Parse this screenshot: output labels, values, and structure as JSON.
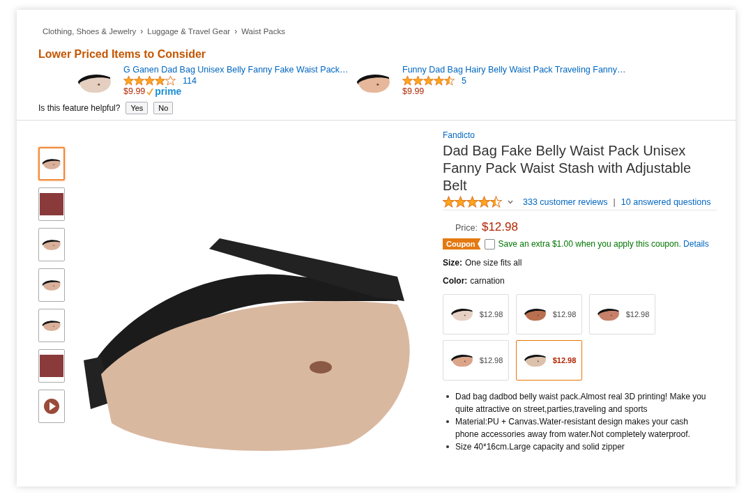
{
  "breadcrumb": [
    {
      "kind": "link",
      "text": "Clothing, Shoes & Jewelry"
    },
    {
      "kind": "separator",
      "text": "›"
    },
    {
      "kind": "link",
      "text": "Luggage & Travel Gear"
    },
    {
      "kind": "separator",
      "text": "›"
    },
    {
      "kind": "link",
      "text": "Waist Packs"
    }
  ],
  "lower_priced": {
    "heading": "Lower Priced Items to Consider",
    "items": [
      {
        "title": "G Ganen Dad Bag Unisex Belly Fanny Fake Waist Pack…",
        "stars": 4,
        "reviews": "114",
        "price": "$9.99",
        "prime": "prime"
      },
      {
        "title": "Funny Dad Bag Hairy Belly Waist Pack Traveling Fanny…",
        "stars": 4.5,
        "reviews": "5",
        "price": "$9.99"
      }
    ],
    "feedback": {
      "question": "Is this feature helpful?",
      "buttons": [
        "Yes",
        "No"
      ]
    }
  },
  "thumbnails": [
    {
      "kind": "pack",
      "selected": true
    },
    {
      "kind": "photo",
      "selected": false
    },
    {
      "kind": "pack",
      "selected": false
    },
    {
      "kind": "pack",
      "selected": false
    },
    {
      "kind": "pack",
      "selected": false
    },
    {
      "kind": "photo",
      "selected": false
    },
    {
      "kind": "video",
      "selected": false
    }
  ],
  "product": {
    "brand": "Fandicto",
    "title": "Dad Bag Fake Belly Waist Pack Unisex Fanny Pack Waist Stash with Adjustable Belt",
    "stars": 4.5,
    "reviews_link": "333 customer reviews",
    "separator": "|",
    "questions_link": "10 answered questions",
    "price_label": "Price:",
    "price": "$12.98",
    "coupon": {
      "badge": "Coupon",
      "checked": false,
      "text": "Save an extra $1.00 when you apply this coupon.",
      "link": "Details"
    },
    "size_label": "Size:",
    "size": "One size fits all",
    "color_label": "Color:",
    "color_value": "carnation",
    "variants": [
      {
        "price": "$12.98",
        "selected": false
      },
      {
        "price": "$12.98",
        "selected": false
      },
      {
        "price": "$12.98",
        "selected": false
      },
      {
        "price": "$12.98",
        "selected": false
      },
      {
        "price": "$12.98",
        "selected": true
      }
    ],
    "bullets": [
      "Dad bag dadbod belly waist pack.Almost real 3D printing! Make you quite attractive on street,parties,traveling and sports",
      "Material:PU + Canvas.Water-resistant design makes your cash phone accessories away from water.Not completely waterproof.",
      "Size 40*16cm.Large capacity and solid zipper"
    ]
  }
}
